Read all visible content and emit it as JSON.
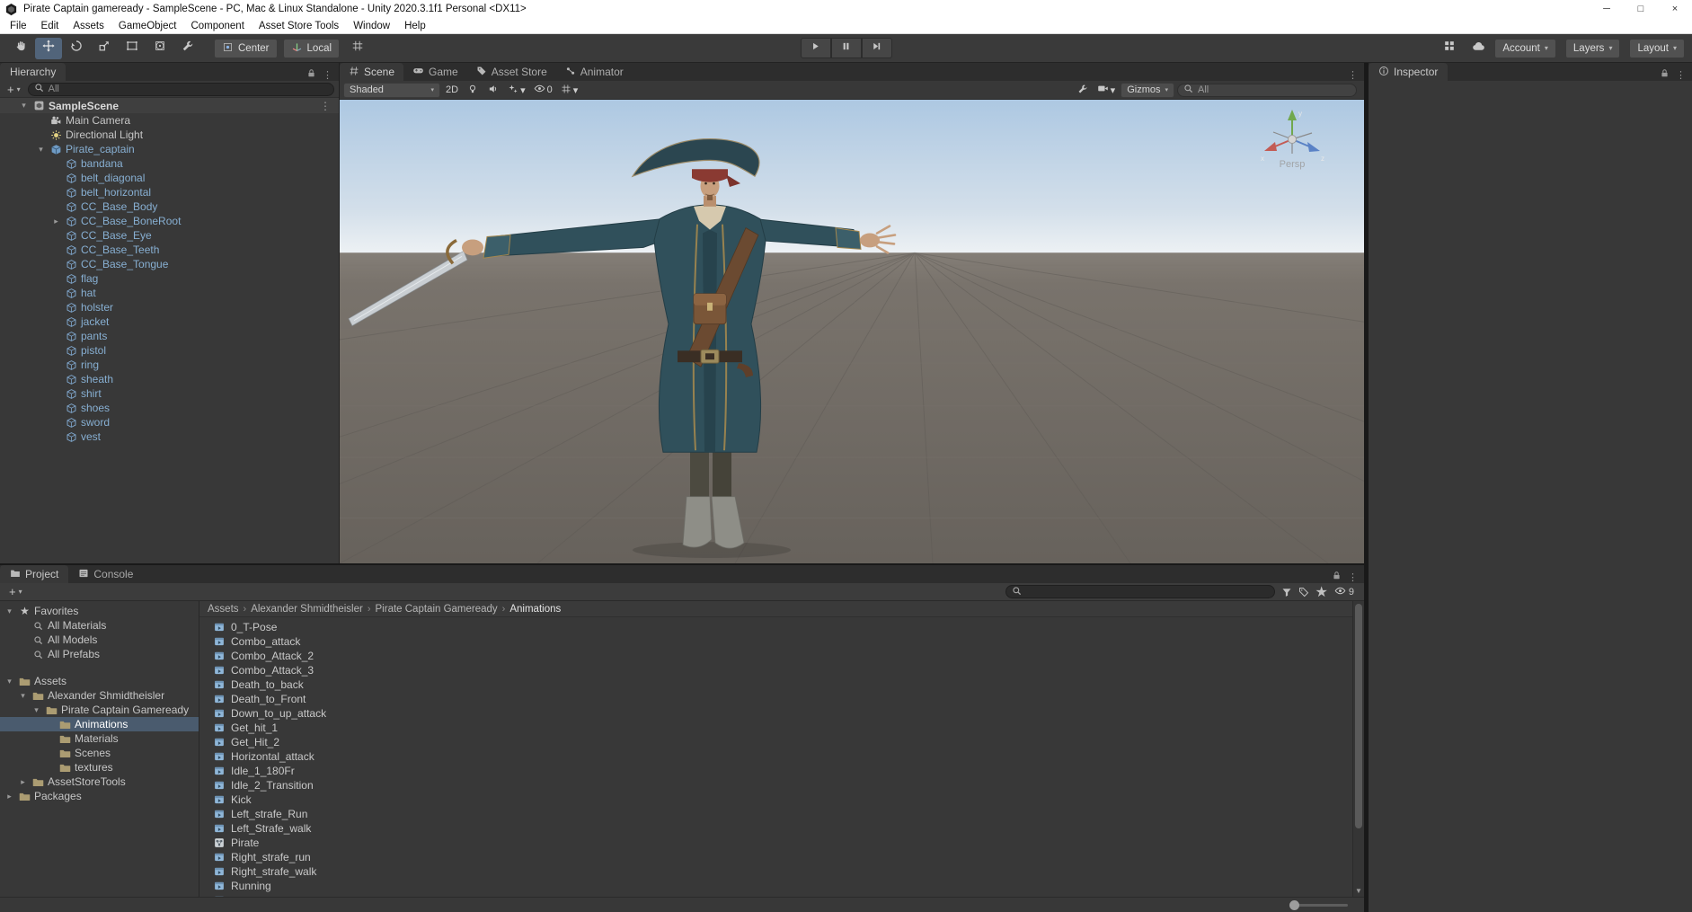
{
  "title_bar": {
    "title": "Pirate Captain gameready - SampleScene - PC, Mac & Linux Standalone - Unity 2020.3.1f1 Personal <DX11>"
  },
  "menu_bar": {
    "items": [
      "File",
      "Edit",
      "Assets",
      "GameObject",
      "Component",
      "Asset Store Tools",
      "Window",
      "Help"
    ]
  },
  "toolbar": {
    "tools": [
      {
        "icon": "hand-tool-icon",
        "selected": false
      },
      {
        "icon": "move-tool-icon",
        "selected": true
      },
      {
        "icon": "rotate-tool-icon",
        "selected": false
      },
      {
        "icon": "scale-tool-icon",
        "selected": false
      },
      {
        "icon": "rect-tool-icon",
        "selected": false
      },
      {
        "icon": "transform-tool-icon",
        "selected": false
      },
      {
        "icon": "custom-tool-icon",
        "selected": false
      }
    ],
    "pivot_label": "Center",
    "space_label": "Local",
    "account_label": "Account",
    "layers_label": "Layers",
    "layout_label": "Layout"
  },
  "hierarchy": {
    "tab_label": "Hierarchy",
    "search_placeholder": "All",
    "scene_name": "SampleScene",
    "items": [
      {
        "label": "Main Camera",
        "icon": "camera-icon",
        "indent": 1
      },
      {
        "label": "Directional Light",
        "icon": "light-icon",
        "indent": 1
      },
      {
        "label": "Pirate_captain",
        "icon": "prefab-icon",
        "indent": 1,
        "prefab": true,
        "arrow": "expanded"
      },
      {
        "label": "bandana",
        "icon": "cube-icon",
        "indent": 2,
        "prefab": true
      },
      {
        "label": "belt_diagonal",
        "icon": "cube-icon",
        "indent": 2,
        "prefab": true
      },
      {
        "label": "belt_horizontal",
        "icon": "cube-icon",
        "indent": 2,
        "prefab": true
      },
      {
        "label": "CC_Base_Body",
        "icon": "cube-icon",
        "indent": 2,
        "prefab": true
      },
      {
        "label": "CC_Base_BoneRoot",
        "icon": "cube-icon",
        "indent": 2,
        "prefab": true,
        "arrow": "collapsed"
      },
      {
        "label": "CC_Base_Eye",
        "icon": "cube-icon",
        "indent": 2,
        "prefab": true
      },
      {
        "label": "CC_Base_Teeth",
        "icon": "cube-icon",
        "indent": 2,
        "prefab": true
      },
      {
        "label": "CC_Base_Tongue",
        "icon": "cube-icon",
        "indent": 2,
        "prefab": true
      },
      {
        "label": "flag",
        "icon": "cube-icon",
        "indent": 2,
        "prefab": true
      },
      {
        "label": "hat",
        "icon": "cube-icon",
        "indent": 2,
        "prefab": true
      },
      {
        "label": "holster",
        "icon": "cube-icon",
        "indent": 2,
        "prefab": true
      },
      {
        "label": "jacket",
        "icon": "cube-icon",
        "indent": 2,
        "prefab": true
      },
      {
        "label": "pants",
        "icon": "cube-icon",
        "indent": 2,
        "prefab": true
      },
      {
        "label": "pistol",
        "icon": "cube-icon",
        "indent": 2,
        "prefab": true
      },
      {
        "label": "ring",
        "icon": "cube-icon",
        "indent": 2,
        "prefab": true
      },
      {
        "label": "sheath",
        "icon": "cube-icon",
        "indent": 2,
        "prefab": true
      },
      {
        "label": "shirt",
        "icon": "cube-icon",
        "indent": 2,
        "prefab": true
      },
      {
        "label": "shoes",
        "icon": "cube-icon",
        "indent": 2,
        "prefab": true
      },
      {
        "label": "sword",
        "icon": "cube-icon",
        "indent": 2,
        "prefab": true
      },
      {
        "label": "vest",
        "icon": "cube-icon",
        "indent": 2,
        "prefab": true
      }
    ]
  },
  "scene_view": {
    "tabs": [
      {
        "label": "Scene",
        "icon": "scene-tab-icon",
        "active": true
      },
      {
        "label": "Game",
        "icon": "game-tab-icon",
        "active": false
      },
      {
        "label": "Asset Store",
        "icon": "asset-store-tab-icon",
        "active": false
      },
      {
        "label": "Animator",
        "icon": "animator-tab-icon",
        "active": false
      }
    ],
    "shading_mode": "Shaded",
    "mode_2d_label": "2D",
    "hidden_objects_count": "0",
    "gizmos_label": "Gizmos",
    "search_placeholder": "All",
    "projection_label": "Persp",
    "axis_labels": {
      "x": "x",
      "y": "y",
      "z": "z"
    }
  },
  "inspector": {
    "tab_label": "Inspector"
  },
  "project": {
    "tab_project": "Project",
    "tab_console": "Console",
    "hidden_packages_count": "9",
    "breadcrumbs": [
      "Assets",
      "Alexander Shmidtheisler",
      "Pirate Captain Gameready",
      "Animations"
    ],
    "favorites_label": "Favorites",
    "favorites": [
      {
        "label": "All Materials",
        "icon": "search-icon"
      },
      {
        "label": "All Models",
        "icon": "search-icon"
      },
      {
        "label": "All Prefabs",
        "icon": "search-icon"
      }
    ],
    "tree": [
      {
        "label": "Assets",
        "icon": "folder-icon",
        "indent": 0,
        "arrow": "expanded"
      },
      {
        "label": "Alexander Shmidtheisler",
        "icon": "folder-icon",
        "indent": 1,
        "arrow": "expanded"
      },
      {
        "label": "Pirate Captain Gameready",
        "icon": "folder-icon",
        "indent": 2,
        "arrow": "expanded"
      },
      {
        "label": "Animations",
        "icon": "folder-icon",
        "indent": 3,
        "selected": true
      },
      {
        "label": "Materials",
        "icon": "folder-icon",
        "indent": 3
      },
      {
        "label": "Scenes",
        "icon": "folder-icon",
        "indent": 3
      },
      {
        "label": "textures",
        "icon": "folder-icon",
        "indent": 3
      },
      {
        "label": "AssetStoreTools",
        "icon": "folder-icon",
        "indent": 1,
        "arrow": "collapsed"
      },
      {
        "label": "Packages",
        "icon": "folder-icon",
        "indent": 0,
        "arrow": "collapsed"
      }
    ],
    "files": [
      {
        "label": "0_T-Pose",
        "icon": "animation-clip-icon"
      },
      {
        "label": "Combo_attack",
        "icon": "animation-clip-icon"
      },
      {
        "label": "Combo_Attack_2",
        "icon": "animation-clip-icon"
      },
      {
        "label": "Combo_Attack_3",
        "icon": "animation-clip-icon"
      },
      {
        "label": "Death_to_back",
        "icon": "animation-clip-icon"
      },
      {
        "label": "Death_to_Front",
        "icon": "animation-clip-icon"
      },
      {
        "label": "Down_to_up_attack",
        "icon": "animation-clip-icon"
      },
      {
        "label": "Get_hit_1",
        "icon": "animation-clip-icon"
      },
      {
        "label": "Get_Hit_2",
        "icon": "animation-clip-icon"
      },
      {
        "label": "Horizontal_attack",
        "icon": "animation-clip-icon"
      },
      {
        "label": "Idle_1_180Fr",
        "icon": "animation-clip-icon"
      },
      {
        "label": "Idle_2_Transition",
        "icon": "animation-clip-icon"
      },
      {
        "label": "Kick",
        "icon": "animation-clip-icon"
      },
      {
        "label": "Left_strafe_Run",
        "icon": "animation-clip-icon"
      },
      {
        "label": "Left_Strafe_walk",
        "icon": "animation-clip-icon"
      },
      {
        "label": "Pirate",
        "icon": "animator-controller-icon"
      },
      {
        "label": "Right_strafe_run",
        "icon": "animation-clip-icon"
      },
      {
        "label": "Right_strafe_walk",
        "icon": "animation-clip-icon"
      },
      {
        "label": "Running",
        "icon": "animation-clip-icon"
      },
      {
        "label": "",
        "icon": "animation-clip-icon"
      }
    ]
  }
}
